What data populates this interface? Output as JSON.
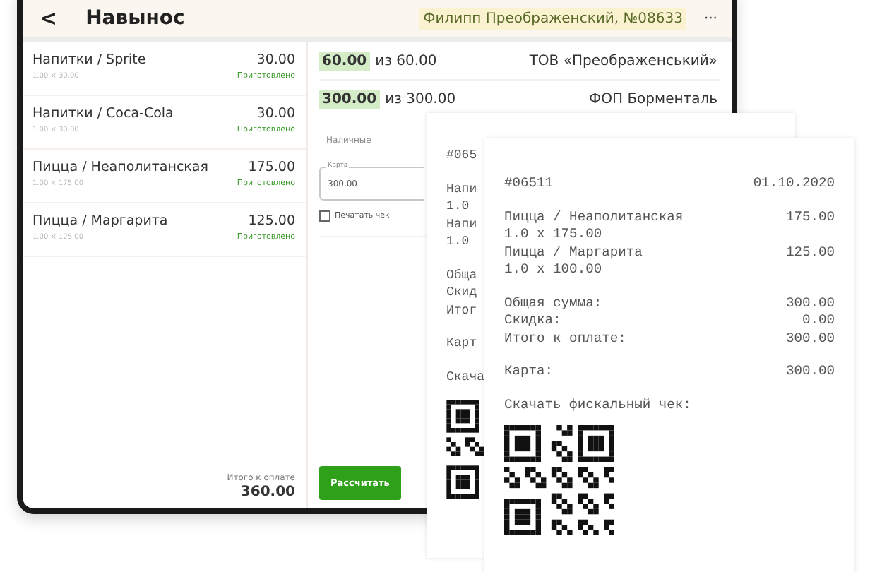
{
  "header": {
    "back": "<",
    "title": "Навынос",
    "customer": "Филипп Преображенский, №08633",
    "more": "···"
  },
  "order_items": [
    {
      "name": "Напитки / Sprite",
      "quantity_price": "1.00 × 30.00",
      "price": "30.00",
      "status": "Приготовлено"
    },
    {
      "name": "Напитки / Coca-Cola",
      "quantity_price": "1.00 × 30.00",
      "price": "30.00",
      "status": "Приготовлено"
    },
    {
      "name": "Пицца / Неаполитанская",
      "quantity_price": "1.00 × 175.00",
      "price": "175.00",
      "status": "Приготовлено"
    },
    {
      "name": "Пицца / Маргарита",
      "quantity_price": "1.00 × 125.00",
      "price": "125.00",
      "status": "Приготовлено"
    }
  ],
  "total": {
    "label": "Итого к оплате",
    "amount": "360.00"
  },
  "payments": [
    {
      "paid": "60.00",
      "of": "из 60.00",
      "payee": "ТОВ «Преображенський»"
    },
    {
      "paid": "300.00",
      "of": "из 300.00",
      "payee": "ФОП Борменталь"
    }
  ],
  "fields": [
    {
      "placeholder": "Наличные"
    },
    {
      "label": "Карта",
      "value": "300.00"
    }
  ],
  "print_receipt": {
    "label": "Печатать чек",
    "checked": false
  },
  "pay_button": "Рассчитать",
  "back_receipt": {
    "number": "#065",
    "items": [
      "Напи",
      "1.0",
      "Напи",
      "1.0"
    ],
    "totals": [
      "Обща",
      "Скид",
      "Итог"
    ],
    "payment": "Карт",
    "download": "Скача"
  },
  "receipt": {
    "number": "#06511",
    "date": "01.10.2020",
    "items": [
      {
        "name": "Пицца / Неаполитанская",
        "price": "175.00",
        "qty": "1.0 x 175.00"
      },
      {
        "name": "Пицца / Маргарита",
        "price": "125.00",
        "qty": "1.0 x 100.00"
      }
    ],
    "totals": [
      {
        "label": "Общая сумма:",
        "value": "300.00"
      },
      {
        "label": "Скидка:",
        "value": "0.00"
      },
      {
        "label": "Итого к оплате:",
        "value": "300.00"
      }
    ],
    "payment": {
      "label": "Карта:",
      "value": "300.00"
    },
    "download": "Скачать фискальный чек:"
  }
}
